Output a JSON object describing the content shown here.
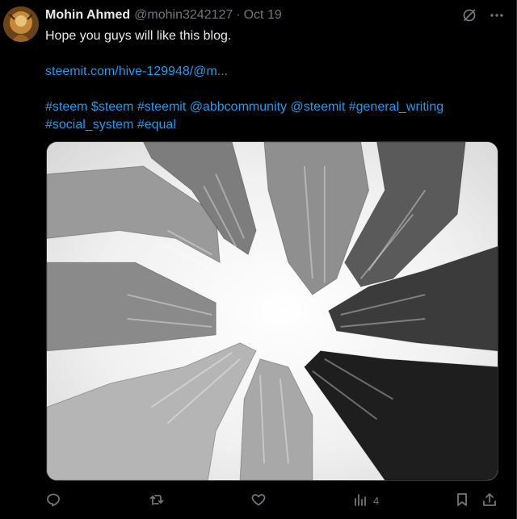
{
  "tweet": {
    "author_name": "Mohin Ahmed",
    "handle": "@mohin3242127",
    "separator": "·",
    "date": "Oct 19",
    "text_line1": "Hope you guys will like this blog.",
    "link": "steemit.com/hive-129948/@m...",
    "hashtags_line1": "#steem $steem #steemit @abbcommunity @steemit #general_writing",
    "hashtags_line2": "#social_system #equal"
  },
  "media": {
    "description_icon": "photo",
    "subject": "hands-circle"
  },
  "actions": {
    "views_count": "4"
  },
  "icons": {
    "grok": "slashed-circle-icon",
    "more": "more-dots-icon",
    "reply": "reply-icon",
    "retweet": "retweet-icon",
    "like": "heart-icon",
    "views": "views-icon",
    "bookmark": "bookmark-icon",
    "share": "share-icon"
  },
  "colors": {
    "background": "#000000",
    "text": "#e7e9ea",
    "muted": "#71767b",
    "link": "#1d9bf0"
  }
}
